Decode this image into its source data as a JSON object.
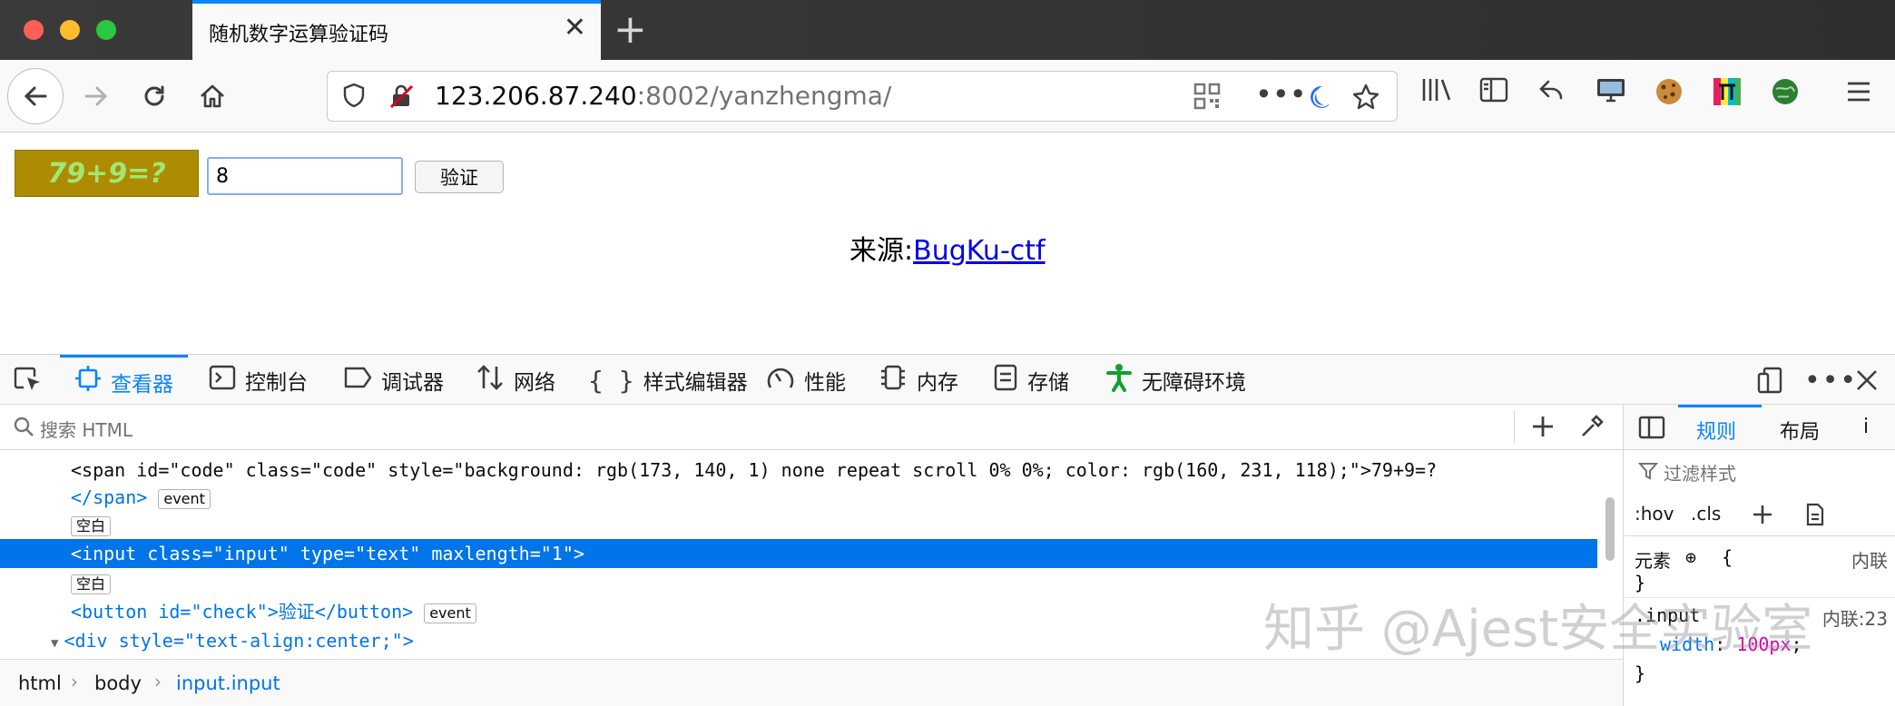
{
  "browser": {
    "tab_title": "随机数字运算验证码",
    "tab_close": "✕",
    "new_tab": "+",
    "url_host": "123.206.87.240",
    "url_rest": ":8002/yanzhengma/"
  },
  "page": {
    "captcha_text": "79+9=?",
    "answer_value": "8",
    "verify_label": "验证",
    "source_label": "来源:",
    "source_link": "BugKu-ctf",
    "colors": {
      "captcha_bg": "#ad8c01",
      "captcha_fg": "#a0e776"
    }
  },
  "devtools": {
    "tabs": [
      {
        "label": "查看器",
        "icon": "inspector-icon"
      },
      {
        "label": "控制台",
        "icon": "console-icon"
      },
      {
        "label": "调试器",
        "icon": "debugger-icon"
      },
      {
        "label": "网络",
        "icon": "network-icon"
      },
      {
        "label": "样式编辑器",
        "icon": "style-editor-icon"
      },
      {
        "label": "性能",
        "icon": "performance-icon"
      },
      {
        "label": "内存",
        "icon": "memory-icon"
      },
      {
        "label": "存储",
        "icon": "storage-icon"
      },
      {
        "label": "无障碍环境",
        "icon": "accessibility-icon"
      }
    ],
    "search_placeholder": "搜索 HTML",
    "markup": {
      "span_open": "<span id=\"code\" class=\"code\" style=\"background: rgb(173, 140, 1) none repeat scroll 0% 0%; color: rgb(160, 231, 118);\">79+9=?",
      "span_close": "</span>",
      "event_badge": "event",
      "whitespace_badge": "空白",
      "input_line": "<input class=\"input\" type=\"text\" maxlength=\"1\">",
      "button_line": "<button id=\"check\">验证</button>",
      "div_line": "<div style=\"text-align:center;\">"
    },
    "breadcrumbs": [
      "html",
      "body",
      "input.input"
    ],
    "sidebar": {
      "tabs": [
        "规则",
        "布局",
        "i"
      ],
      "filter_placeholder": "过滤样式",
      "hov": ":hov",
      "cls": ".cls",
      "element_label": "元素",
      "brace_open": "{",
      "brace_close": "}",
      "inline_label": "内联",
      "rule_selector": ".input",
      "rule_source": "内联:23",
      "rule_prop": "width",
      "rule_value": "100px"
    }
  },
  "watermark": "知乎 @Ajest安全实验室"
}
